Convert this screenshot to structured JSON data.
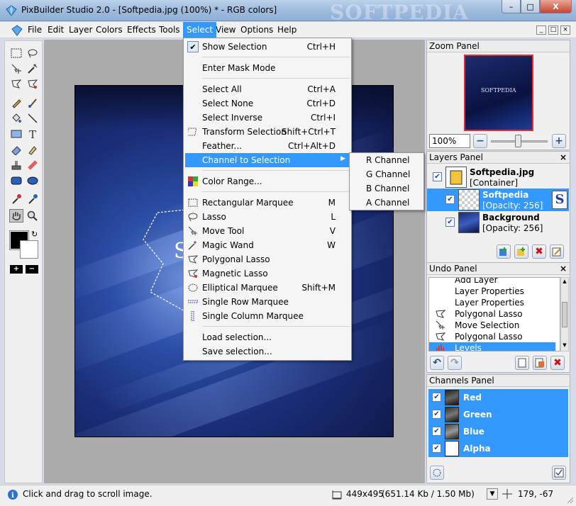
{
  "window": {
    "title": "PixBuilder Studio 2.0 - [Softpedia.jpg (100%) * - RGB colors]",
    "watermark": "SOFTPEDIA",
    "buttons": {
      "minimize": "–",
      "maximize": "□",
      "close": "X"
    }
  },
  "menubar": {
    "items": [
      "File",
      "Edit",
      "Layer",
      "Colors",
      "Effects",
      "Tools",
      "Select",
      "View",
      "Options",
      "Help"
    ],
    "active": "Select",
    "mdi": {
      "minimize": "_",
      "restore": "□",
      "close": "×"
    }
  },
  "select_menu": {
    "items": [
      {
        "label": "Show Selection",
        "shortcut": "Ctrl+H",
        "icon": "checkmark-icon"
      },
      {
        "label": "Enter Mask Mode",
        "shortcut": ""
      },
      {
        "label": "Select All",
        "shortcut": "Ctrl+A"
      },
      {
        "label": "Select None",
        "shortcut": "Ctrl+D"
      },
      {
        "label": "Select Inverse",
        "shortcut": "Ctrl+I"
      },
      {
        "label": "Transform Selection",
        "shortcut": "Shift+Ctrl+T",
        "icon": "transform-selection-icon"
      },
      {
        "label": "Feather...",
        "shortcut": "Ctrl+Alt+D"
      },
      {
        "label": "Channel to Selection",
        "shortcut": "",
        "has_submenu": true
      },
      {
        "label": "Color Range...",
        "shortcut": "",
        "icon": "color-range-icon"
      },
      {
        "label": "Rectangular Marquee",
        "shortcut": "M",
        "icon": "rectangular-marquee-icon"
      },
      {
        "label": "Lasso",
        "shortcut": "L",
        "icon": "lasso-icon"
      },
      {
        "label": "Move Tool",
        "shortcut": "V",
        "icon": "move-tool-icon"
      },
      {
        "label": "Magic Wand",
        "shortcut": "W",
        "icon": "magic-wand-icon"
      },
      {
        "label": "Polygonal Lasso",
        "shortcut": "",
        "icon": "polygonal-lasso-icon"
      },
      {
        "label": "Magnetic Lasso",
        "shortcut": "",
        "icon": "magnetic-lasso-icon"
      },
      {
        "label": "Elliptical Marquee",
        "shortcut": "Shift+M",
        "icon": "elliptical-marquee-icon"
      },
      {
        "label": "Single Row Marquee",
        "shortcut": "",
        "icon": "single-row-marquee-icon"
      },
      {
        "label": "Single Column Marquee",
        "shortcut": "",
        "icon": "single-column-marquee-icon"
      },
      {
        "label": "Load selection...",
        "shortcut": ""
      },
      {
        "label": "Save selection...",
        "shortcut": ""
      }
    ],
    "highlighted": "Channel to Selection"
  },
  "channel_submenu": {
    "items": [
      "R Channel",
      "G Channel",
      "B Channel",
      "A Channel"
    ]
  },
  "image": {
    "text": "S"
  },
  "zoom_panel": {
    "title": "Zoom Panel",
    "zoom_value": "100%",
    "minus": "−",
    "plus": "+",
    "thumb_text": "SOFTPEDIA",
    "zoom_level": 0.5
  },
  "layers_panel": {
    "title": "Layers Panel",
    "layers": [
      {
        "name": "Softpedia.jpg",
        "sub": "[Container]",
        "visible": true
      },
      {
        "name": "Softpedia",
        "sub": "[Opacity: 256]",
        "visible": true,
        "selected": true
      },
      {
        "name": "Background",
        "sub": "[Opacity: 256]",
        "visible": true
      }
    ]
  },
  "undo_panel": {
    "title": "Undo Panel",
    "items": [
      "Add Layer",
      "Layer Properties",
      "Layer Properties",
      "Polygonal Lasso",
      "Move Selection",
      "Polygonal Lasso",
      "Levels"
    ],
    "selected": "Levels"
  },
  "channels_panel": {
    "title": "Channels Panel",
    "channels": [
      "Red",
      "Green",
      "Blue",
      "Alpha"
    ]
  },
  "statusbar": {
    "message": "Click and drag to scroll image.",
    "image_size": "449x495",
    "file_size": "(651.14 Kb / 1.50 Mb)",
    "coords": "179, -67"
  },
  "colors": {
    "accent": "#3399ff",
    "close_red": "#e03030"
  }
}
